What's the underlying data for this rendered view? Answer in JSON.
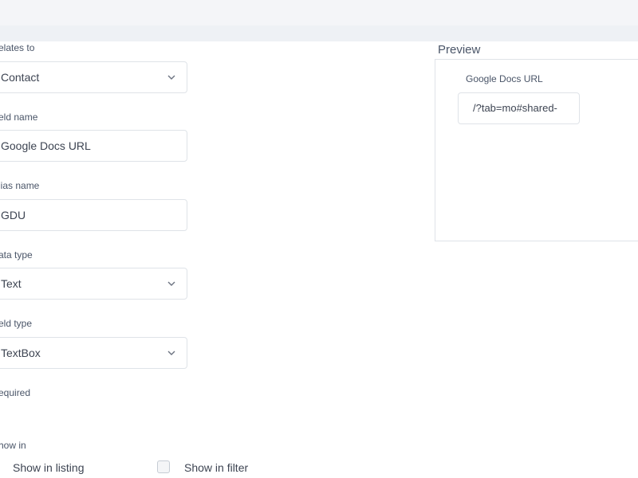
{
  "form": {
    "relates_to": {
      "label": "elates to",
      "value": "Contact"
    },
    "field_name": {
      "label": "eld name",
      "value": "Google Docs URL"
    },
    "alias_name": {
      "label": "lias name",
      "value": "GDU"
    },
    "data_type": {
      "label": "ata type",
      "value": "Text"
    },
    "field_type": {
      "label": "eld type",
      "value": "TextBox"
    },
    "required": {
      "label": "equired"
    },
    "show_in": {
      "label": "how in",
      "listing_label": "Show in listing",
      "filter_label": "Show in filter",
      "filter_checked": false
    }
  },
  "preview": {
    "title": "Preview",
    "field_label": "Google Docs URL",
    "field_value": "/?tab=mo#shared-"
  },
  "icons": {
    "dropdown": "chevron-down-icon"
  }
}
